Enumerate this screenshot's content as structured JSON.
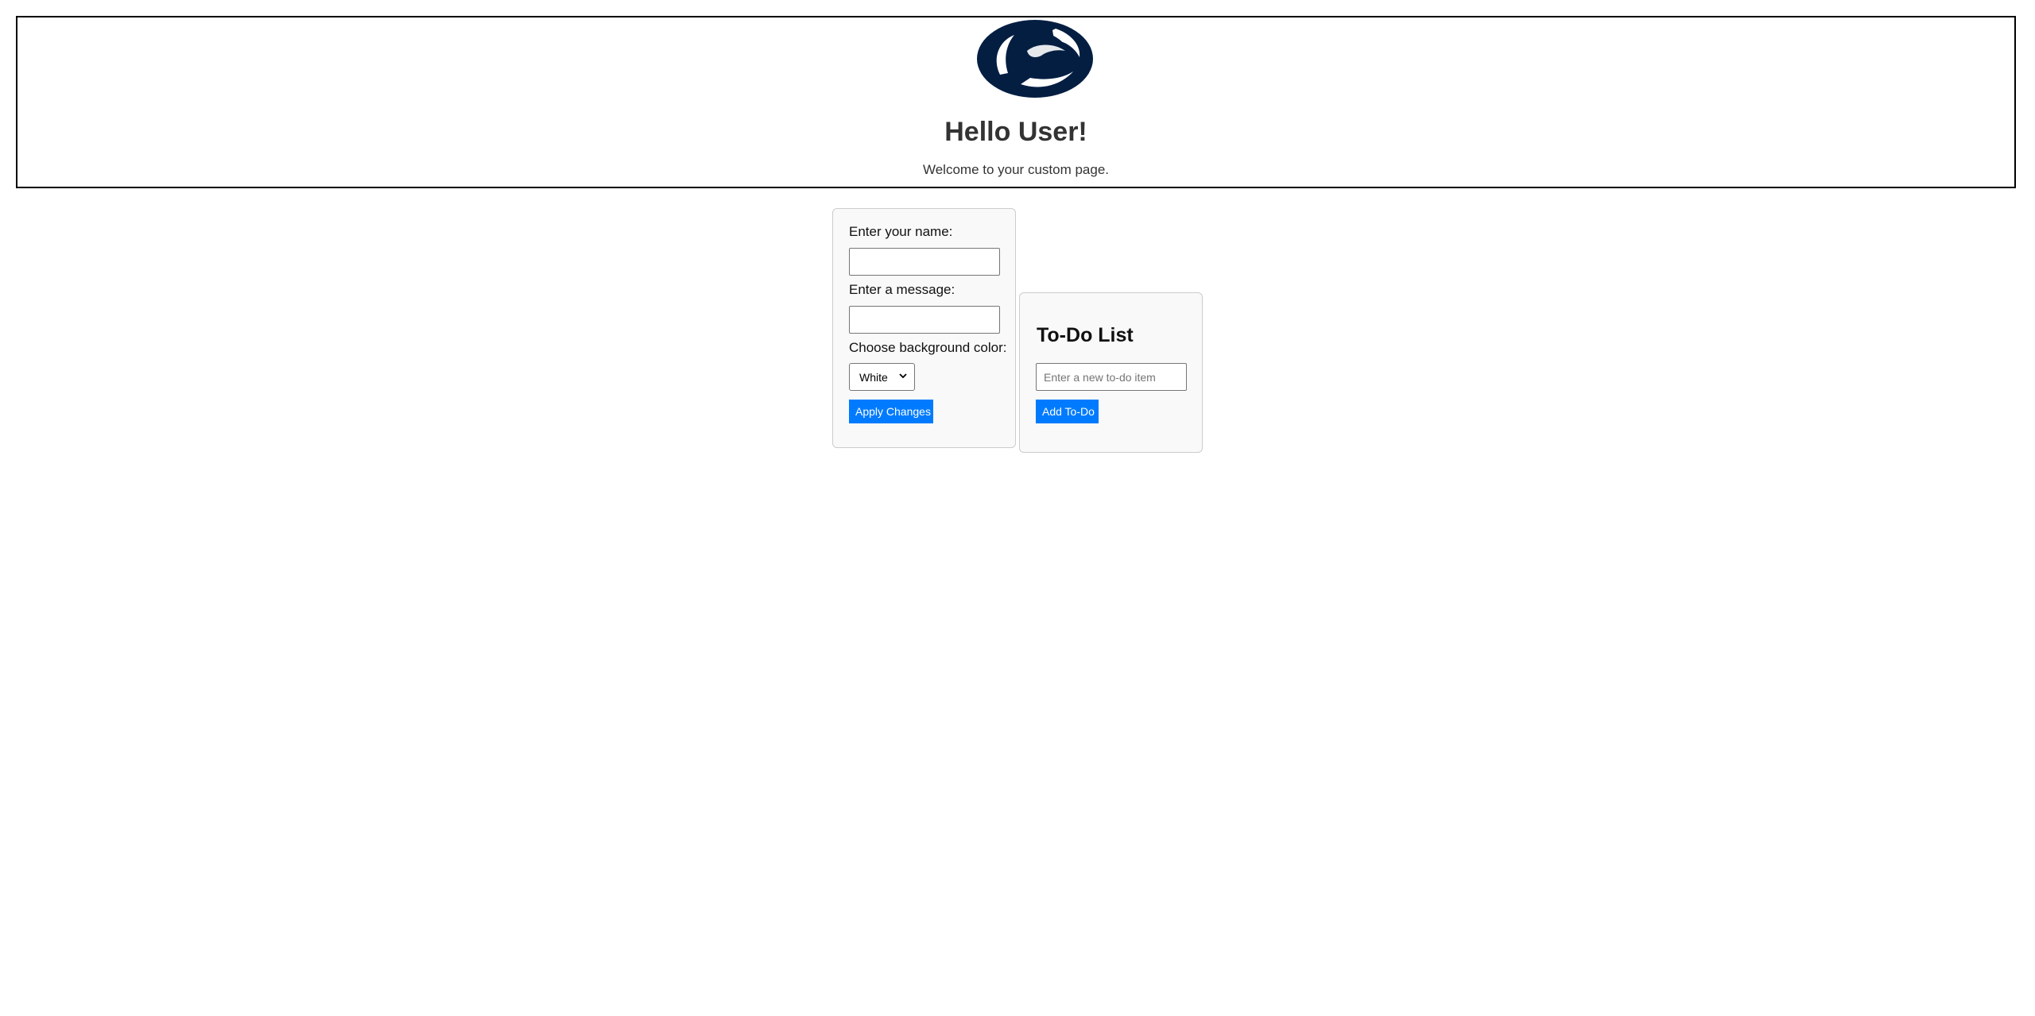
{
  "header": {
    "logo_icon": "nittany-lion-logo-icon",
    "logo_color": "#041e42",
    "title": "Hello User!",
    "subtitle": "Welcome to your custom page."
  },
  "form": {
    "name_label": "Enter your name:",
    "name_value": "",
    "message_label": "Enter a message:",
    "message_value": "",
    "color_label": "Choose background color:",
    "color_selected": "White",
    "apply_label": "Apply Changes"
  },
  "todo": {
    "title": "To-Do List",
    "input_placeholder": "Enter a new to-do item",
    "input_value": "",
    "add_label": "Add To-Do"
  },
  "colors": {
    "button_blue": "#007bff",
    "panel_bg": "#f9f9f9",
    "panel_border": "#cccccc"
  }
}
